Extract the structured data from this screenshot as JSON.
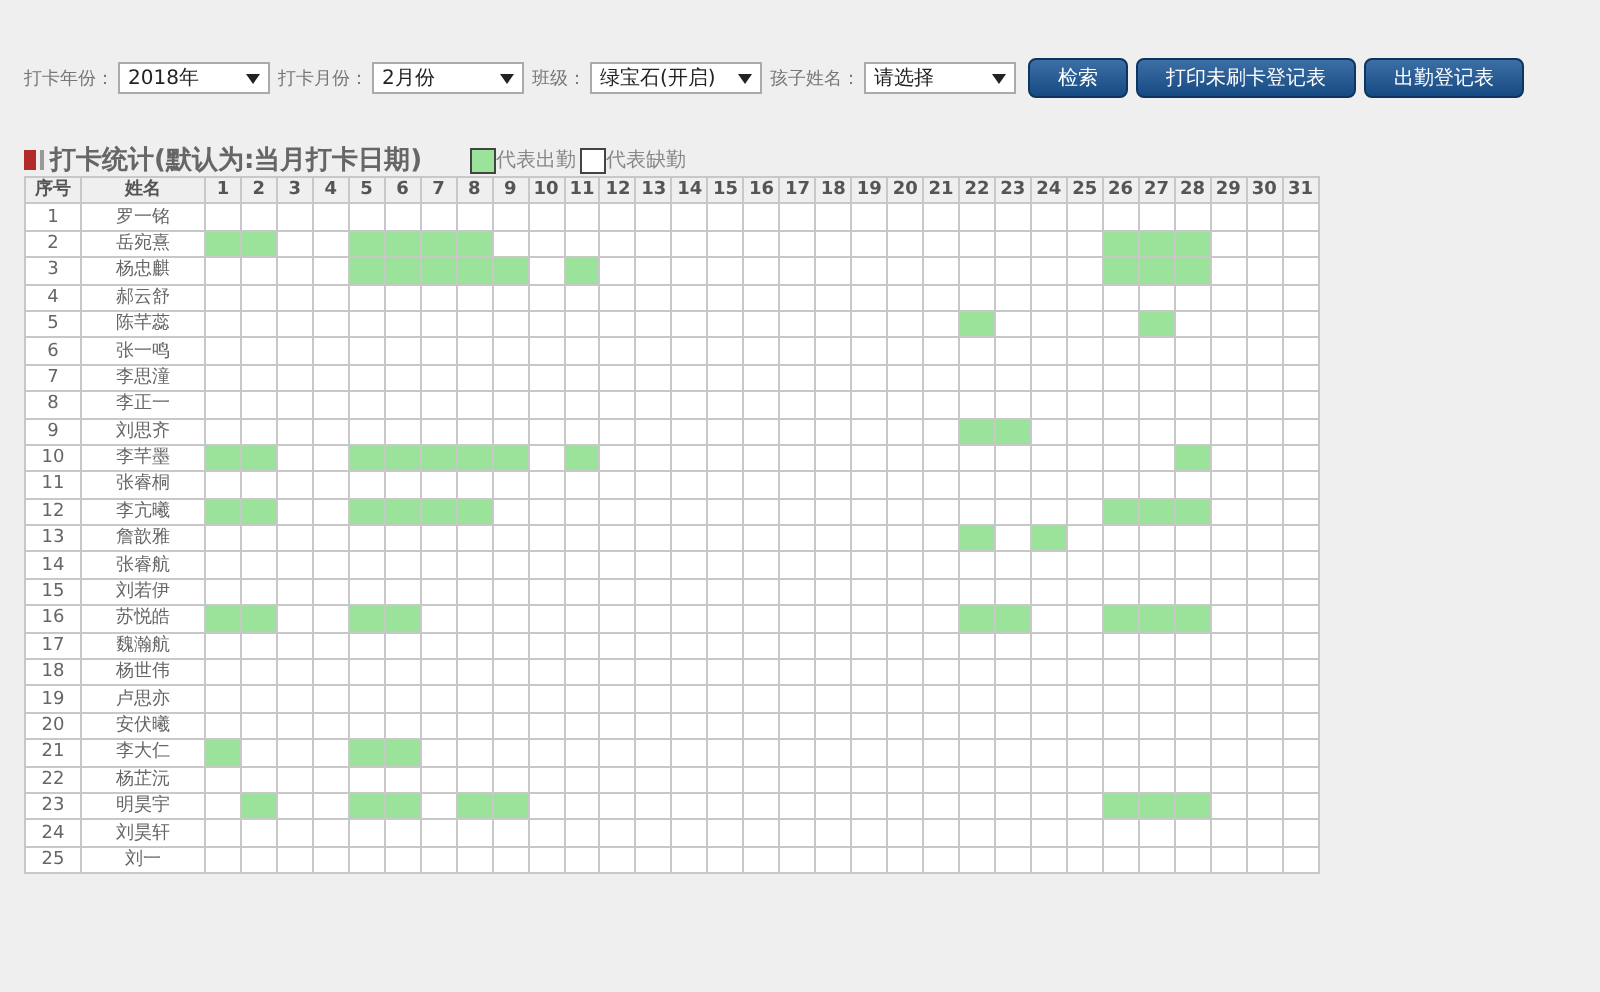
{
  "filters": [
    {
      "label": "打卡年份：",
      "value": "2018年"
    },
    {
      "label": "打卡月份：",
      "value": "2月份"
    },
    {
      "label": "班级：",
      "value": "绿宝石(开启)"
    },
    {
      "label": "孩子姓名：",
      "value": "请选择"
    }
  ],
  "buttons": [
    "检索",
    "打印未刷卡登记表",
    "出勤登记表"
  ],
  "section_title": "打卡统计(默认为:当月打卡日期)",
  "legend": [
    {
      "label": "代表出勤",
      "present": true
    },
    {
      "label": "代表缺勤",
      "present": false
    }
  ],
  "table": {
    "columns": [
      "序号",
      "姓名",
      "1",
      "2",
      "3",
      "4",
      "5",
      "6",
      "7",
      "8",
      "9",
      "10",
      "11",
      "12",
      "13",
      "14",
      "15",
      "16",
      "17",
      "18",
      "19",
      "20",
      "21",
      "22",
      "23",
      "24",
      "25",
      "26",
      "27",
      "28",
      "29",
      "30",
      "31"
    ],
    "rows": [
      {
        "no": "1",
        "name": "罗一铭",
        "present": [
          false,
          false,
          false,
          false,
          false,
          false,
          false,
          false,
          false,
          false,
          false,
          false,
          false,
          false,
          false,
          false,
          false,
          false,
          false,
          false,
          false,
          false,
          false,
          false,
          false,
          false,
          false,
          false,
          false,
          false,
          false
        ]
      },
      {
        "no": "2",
        "name": "岳宛熹",
        "present": [
          true,
          true,
          false,
          false,
          true,
          true,
          true,
          true,
          false,
          false,
          false,
          false,
          false,
          false,
          false,
          false,
          false,
          false,
          false,
          false,
          false,
          false,
          false,
          false,
          false,
          true,
          true,
          true,
          false,
          false,
          false
        ]
      },
      {
        "no": "3",
        "name": "杨忠麒",
        "present": [
          false,
          false,
          false,
          false,
          true,
          true,
          true,
          true,
          true,
          false,
          true,
          false,
          false,
          false,
          false,
          false,
          false,
          false,
          false,
          false,
          false,
          false,
          false,
          false,
          false,
          true,
          true,
          true,
          false,
          false,
          false
        ]
      },
      {
        "no": "4",
        "name": "郝云舒",
        "present": [
          false,
          false,
          false,
          false,
          false,
          false,
          false,
          false,
          false,
          false,
          false,
          false,
          false,
          false,
          false,
          false,
          false,
          false,
          false,
          false,
          false,
          false,
          false,
          false,
          false,
          false,
          false,
          false,
          false,
          false,
          false
        ]
      },
      {
        "no": "5",
        "name": "陈芊蕊",
        "present": [
          false,
          false,
          false,
          false,
          false,
          false,
          false,
          false,
          false,
          false,
          false,
          false,
          false,
          false,
          false,
          false,
          false,
          false,
          false,
          false,
          false,
          true,
          false,
          false,
          false,
          false,
          true,
          false,
          false,
          false,
          false
        ]
      },
      {
        "no": "6",
        "name": "张一鸣",
        "present": [
          false,
          false,
          false,
          false,
          false,
          false,
          false,
          false,
          false,
          false,
          false,
          false,
          false,
          false,
          false,
          false,
          false,
          false,
          false,
          false,
          false,
          false,
          false,
          false,
          false,
          false,
          false,
          false,
          false,
          false,
          false
        ]
      },
      {
        "no": "7",
        "name": "李思潼",
        "present": [
          false,
          false,
          false,
          false,
          false,
          false,
          false,
          false,
          false,
          false,
          false,
          false,
          false,
          false,
          false,
          false,
          false,
          false,
          false,
          false,
          false,
          false,
          false,
          false,
          false,
          false,
          false,
          false,
          false,
          false,
          false
        ]
      },
      {
        "no": "8",
        "name": "李正一",
        "present": [
          false,
          false,
          false,
          false,
          false,
          false,
          false,
          false,
          false,
          false,
          false,
          false,
          false,
          false,
          false,
          false,
          false,
          false,
          false,
          false,
          false,
          false,
          false,
          false,
          false,
          false,
          false,
          false,
          false,
          false,
          false
        ]
      },
      {
        "no": "9",
        "name": "刘思齐",
        "present": [
          false,
          false,
          false,
          false,
          false,
          false,
          false,
          false,
          false,
          false,
          false,
          false,
          false,
          false,
          false,
          false,
          false,
          false,
          false,
          false,
          false,
          true,
          true,
          false,
          false,
          false,
          false,
          false,
          false,
          false,
          false
        ]
      },
      {
        "no": "10",
        "name": "李芊墨",
        "present": [
          true,
          true,
          false,
          false,
          true,
          true,
          true,
          true,
          true,
          false,
          true,
          false,
          false,
          false,
          false,
          false,
          false,
          false,
          false,
          false,
          false,
          false,
          false,
          false,
          false,
          false,
          false,
          true,
          false,
          false,
          false
        ]
      },
      {
        "no": "11",
        "name": "张睿桐",
        "present": [
          false,
          false,
          false,
          false,
          false,
          false,
          false,
          false,
          false,
          false,
          false,
          false,
          false,
          false,
          false,
          false,
          false,
          false,
          false,
          false,
          false,
          false,
          false,
          false,
          false,
          false,
          false,
          false,
          false,
          false,
          false
        ]
      },
      {
        "no": "12",
        "name": "李亢曦",
        "present": [
          true,
          true,
          false,
          false,
          true,
          true,
          true,
          true,
          false,
          false,
          false,
          false,
          false,
          false,
          false,
          false,
          false,
          false,
          false,
          false,
          false,
          false,
          false,
          false,
          false,
          true,
          true,
          true,
          false,
          false,
          false
        ]
      },
      {
        "no": "13",
        "name": "詹歆雅",
        "present": [
          false,
          false,
          false,
          false,
          false,
          false,
          false,
          false,
          false,
          false,
          false,
          false,
          false,
          false,
          false,
          false,
          false,
          false,
          false,
          false,
          false,
          true,
          false,
          true,
          false,
          false,
          false,
          false,
          false,
          false,
          false
        ]
      },
      {
        "no": "14",
        "name": "张睿航",
        "present": [
          false,
          false,
          false,
          false,
          false,
          false,
          false,
          false,
          false,
          false,
          false,
          false,
          false,
          false,
          false,
          false,
          false,
          false,
          false,
          false,
          false,
          false,
          false,
          false,
          false,
          false,
          false,
          false,
          false,
          false,
          false
        ]
      },
      {
        "no": "15",
        "name": "刘若伊",
        "present": [
          false,
          false,
          false,
          false,
          false,
          false,
          false,
          false,
          false,
          false,
          false,
          false,
          false,
          false,
          false,
          false,
          false,
          false,
          false,
          false,
          false,
          false,
          false,
          false,
          false,
          false,
          false,
          false,
          false,
          false,
          false
        ]
      },
      {
        "no": "16",
        "name": "苏悦皓",
        "present": [
          true,
          true,
          false,
          false,
          true,
          true,
          false,
          false,
          false,
          false,
          false,
          false,
          false,
          false,
          false,
          false,
          false,
          false,
          false,
          false,
          false,
          true,
          true,
          false,
          false,
          true,
          true,
          true,
          false,
          false,
          false
        ]
      },
      {
        "no": "17",
        "name": "魏瀚航",
        "present": [
          false,
          false,
          false,
          false,
          false,
          false,
          false,
          false,
          false,
          false,
          false,
          false,
          false,
          false,
          false,
          false,
          false,
          false,
          false,
          false,
          false,
          false,
          false,
          false,
          false,
          false,
          false,
          false,
          false,
          false,
          false
        ]
      },
      {
        "no": "18",
        "name": "杨世伟",
        "present": [
          false,
          false,
          false,
          false,
          false,
          false,
          false,
          false,
          false,
          false,
          false,
          false,
          false,
          false,
          false,
          false,
          false,
          false,
          false,
          false,
          false,
          false,
          false,
          false,
          false,
          false,
          false,
          false,
          false,
          false,
          false
        ]
      },
      {
        "no": "19",
        "name": "卢思亦",
        "present": [
          false,
          false,
          false,
          false,
          false,
          false,
          false,
          false,
          false,
          false,
          false,
          false,
          false,
          false,
          false,
          false,
          false,
          false,
          false,
          false,
          false,
          false,
          false,
          false,
          false,
          false,
          false,
          false,
          false,
          false,
          false
        ]
      },
      {
        "no": "20",
        "name": "安伏曦",
        "present": [
          false,
          false,
          false,
          false,
          false,
          false,
          false,
          false,
          false,
          false,
          false,
          false,
          false,
          false,
          false,
          false,
          false,
          false,
          false,
          false,
          false,
          false,
          false,
          false,
          false,
          false,
          false,
          false,
          false,
          false,
          false
        ]
      },
      {
        "no": "21",
        "name": "李大仁",
        "present": [
          true,
          false,
          false,
          false,
          true,
          true,
          false,
          false,
          false,
          false,
          false,
          false,
          false,
          false,
          false,
          false,
          false,
          false,
          false,
          false,
          false,
          false,
          false,
          false,
          false,
          false,
          false,
          false,
          false,
          false,
          false
        ]
      },
      {
        "no": "22",
        "name": "杨芷沅",
        "present": [
          false,
          false,
          false,
          false,
          false,
          false,
          false,
          false,
          false,
          false,
          false,
          false,
          false,
          false,
          false,
          false,
          false,
          false,
          false,
          false,
          false,
          false,
          false,
          false,
          false,
          false,
          false,
          false,
          false,
          false,
          false
        ]
      },
      {
        "no": "23",
        "name": "明昊宇",
        "present": [
          false,
          true,
          false,
          false,
          true,
          true,
          false,
          true,
          true,
          false,
          false,
          false,
          false,
          false,
          false,
          false,
          false,
          false,
          false,
          false,
          false,
          false,
          false,
          false,
          false,
          true,
          true,
          true,
          false,
          false,
          false
        ]
      },
      {
        "no": "24",
        "name": "刘昊轩",
        "present": [
          false,
          false,
          false,
          false,
          false,
          false,
          false,
          false,
          false,
          false,
          false,
          false,
          false,
          false,
          false,
          false,
          false,
          false,
          false,
          false,
          false,
          false,
          false,
          false,
          false,
          false,
          false,
          false,
          false,
          false,
          false
        ]
      },
      {
        "no": "25",
        "name": "刘一",
        "present": [
          false,
          false,
          false,
          false,
          false,
          false,
          false,
          false,
          false,
          false,
          false,
          false,
          false,
          false,
          false,
          false,
          false,
          false,
          false,
          false,
          false,
          false,
          false,
          false,
          false,
          false,
          false,
          false,
          false,
          false,
          false
        ]
      }
    ]
  }
}
